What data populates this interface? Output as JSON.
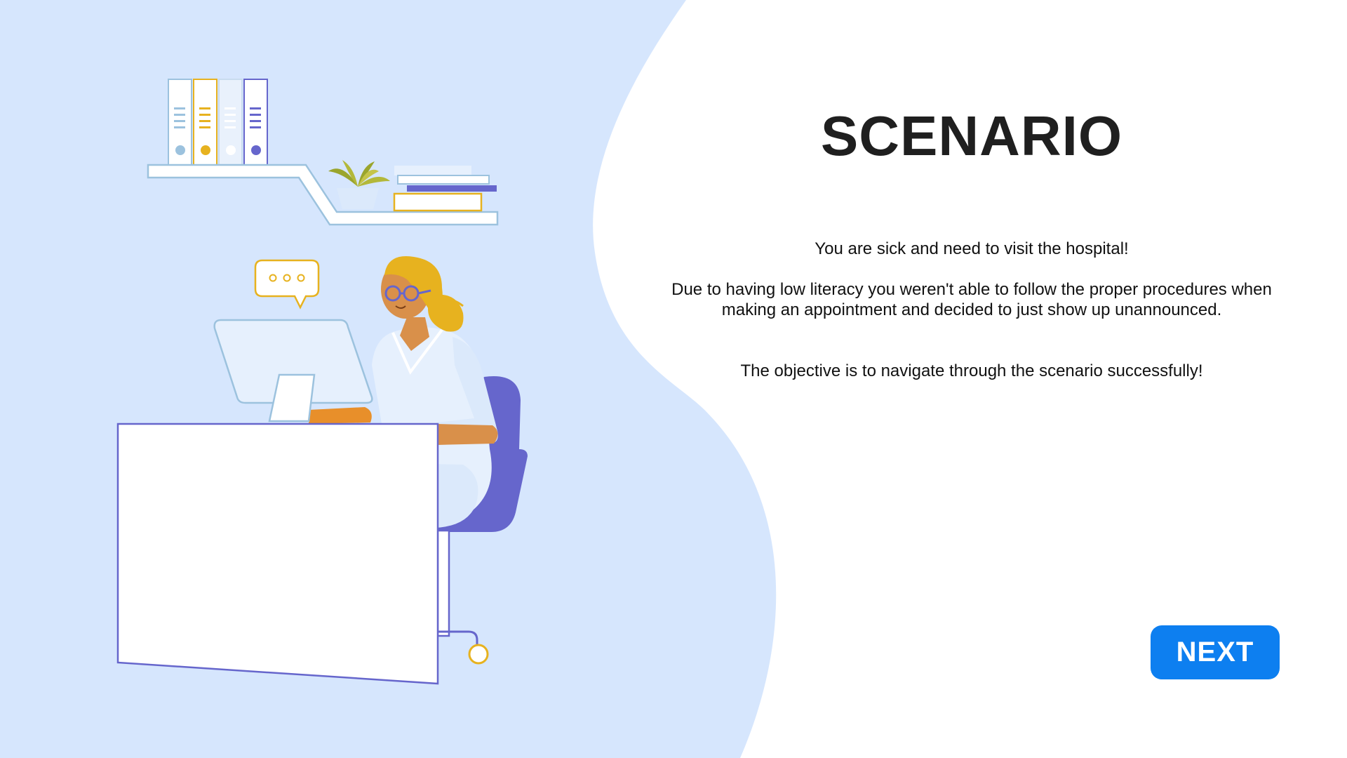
{
  "slide": {
    "title": "SCENARIO",
    "paragraphs": [
      "You are sick and need to visit the hospital!",
      "Due to having low literacy you weren't able to follow the proper procedures when making an appointment and decided to just show up unannounced.",
      "The objective is to navigate through the scenario successfully!"
    ]
  },
  "navigation": {
    "next_label": "NEXT"
  },
  "colors": {
    "background": "#ffffff",
    "wave": "#d6e6fd",
    "accent": "#0d7ff0",
    "illustration_purple": "#6666cc",
    "illustration_yellow": "#e7b21f",
    "illustration_skin": "#d9904a"
  },
  "illustration": {
    "subject": "woman-working-at-computer-desk",
    "icons": [
      "bookshelf-icon",
      "binder-icon",
      "plant-icon",
      "books-icon",
      "speech-bubble-icon",
      "computer-monitor-icon",
      "desk-icon",
      "office-chair-icon",
      "woman-figure-icon"
    ]
  }
}
